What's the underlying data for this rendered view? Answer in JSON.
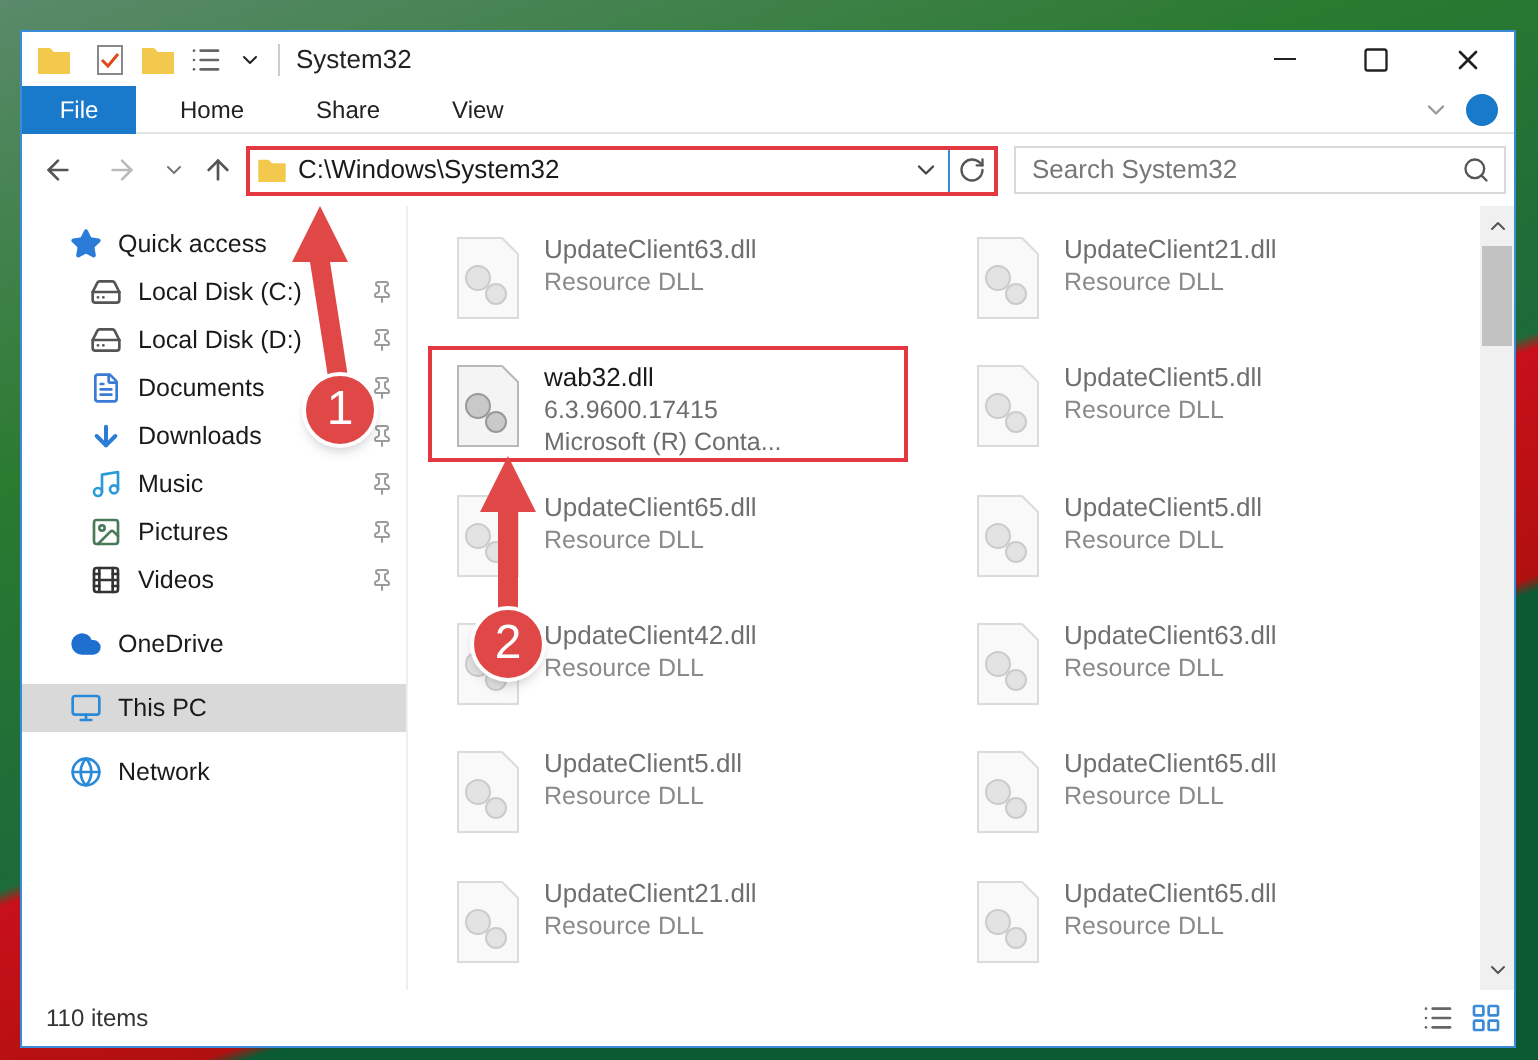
{
  "window": {
    "title": "System32"
  },
  "ribbon_tabs": [
    {
      "label": "File",
      "selected": true
    },
    {
      "label": "Home",
      "selected": false
    },
    {
      "label": "Share",
      "selected": false
    },
    {
      "label": "View",
      "selected": false
    }
  ],
  "address_bar": {
    "path": "C:\\Windows\\System32",
    "highlighted": true
  },
  "search": {
    "placeholder": "Search System32"
  },
  "nav_pane": {
    "items": [
      {
        "label": "Quick access",
        "kind": "quick",
        "selected": false,
        "pinned": false,
        "children": [
          {
            "label": "Local Disk (C:)",
            "kind": "disk",
            "selected": false,
            "pinned": true
          },
          {
            "label": "Local Disk (D:)",
            "kind": "disk",
            "selected": false,
            "pinned": true
          },
          {
            "label": "Documents",
            "kind": "documents",
            "selected": false,
            "pinned": true
          },
          {
            "label": "Downloads",
            "kind": "downloads",
            "selected": false,
            "pinned": true
          },
          {
            "label": "Music",
            "kind": "music",
            "selected": false,
            "pinned": true
          },
          {
            "label": "Pictures",
            "kind": "pictures",
            "selected": false,
            "pinned": true
          },
          {
            "label": "Videos",
            "kind": "videos",
            "selected": false,
            "pinned": true
          }
        ]
      },
      {
        "label": "OneDrive",
        "kind": "cloud",
        "selected": false,
        "pinned": false
      },
      {
        "label": "This PC",
        "kind": "pc",
        "selected": true,
        "pinned": false
      },
      {
        "label": "Network",
        "kind": "network",
        "selected": false,
        "pinned": false
      }
    ]
  },
  "files": [
    {
      "name": "UpdateClient63.dll",
      "line_2": "Resource DLL",
      "blurred": true,
      "highlighted": false
    },
    {
      "name": "UpdateClient21.dll",
      "line_2": "Resource DLL",
      "blurred": true,
      "highlighted": false
    },
    {
      "name": "wab32.dll",
      "line_2": "6.3.9600.17415",
      "line_3": "Microsoft (R) Conta...",
      "blurred": false,
      "highlighted": true
    },
    {
      "name": "UpdateClient5.dll",
      "line_2": "Resource DLL",
      "blurred": true,
      "highlighted": false
    },
    {
      "name": "UpdateClient65.dll",
      "line_2": "Resource DLL",
      "blurred": true,
      "highlighted": false
    },
    {
      "name": "UpdateClient5.dll",
      "line_2": "Resource DLL",
      "blurred": true,
      "highlighted": false
    },
    {
      "name": "UpdateClient42.dll",
      "line_2": "Resource DLL",
      "blurred": true,
      "highlighted": false
    },
    {
      "name": "UpdateClient63.dll",
      "line_2": "Resource DLL",
      "blurred": true,
      "highlighted": false
    },
    {
      "name": "UpdateClient5.dll",
      "line_2": "Resource DLL",
      "blurred": true,
      "highlighted": false
    },
    {
      "name": "UpdateClient65.dll",
      "line_2": "Resource DLL",
      "blurred": true,
      "highlighted": false
    },
    {
      "name": "UpdateClient21.dll",
      "line_2": "Resource DLL",
      "blurred": true,
      "highlighted": false
    },
    {
      "name": "UpdateClient65.dll",
      "line_2": "Resource DLL",
      "blurred": true,
      "highlighted": false
    }
  ],
  "status_bar": {
    "item_count": "110 items"
  },
  "annotations": [
    {
      "label": "1"
    },
    {
      "label": "2"
    }
  ]
}
